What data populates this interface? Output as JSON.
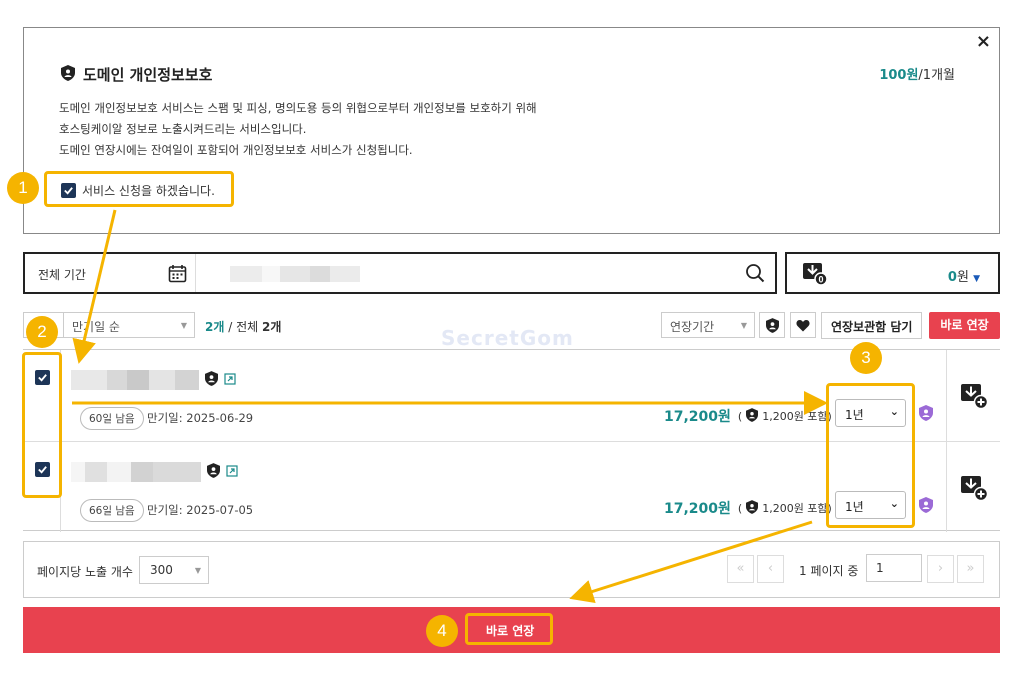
{
  "info": {
    "title": "도메인 개인정보보호",
    "price_strong": "100원",
    "price_suffix": "/1개월",
    "desc_1": "도메인 개인정보보호 서비스는 스팸 및 피싱, 명의도용 등의 위협으로부터 개인정보를 보호하기 위해",
    "desc_2": "호스팅케이알 정보로 노출시켜드리는 서비스입니다.",
    "desc_3": "도메인 연장시에는 잔여일이 포함되어 개인정보보호 서비스가 신청됩니다.",
    "service_check_label": "서비스 신청을 하겠습니다.",
    "close_label": "×"
  },
  "search": {
    "period_label": "전체 기간"
  },
  "cart": {
    "amount": "0",
    "unit": "원"
  },
  "toolbar": {
    "sort_label": "만기일 순",
    "count_selected": "2개",
    "count_sep": " / 전체 ",
    "count_total": "2개",
    "period_filter_label": "연장기간",
    "add_cart_label": "연장보관함 담기",
    "renew_now_label": "바로 연장"
  },
  "watermark": "SecretGom",
  "domains": [
    {
      "days_left": "60일 남음",
      "expiry": "만기일: 2025-06-29",
      "price": "17,200원",
      "price_open": "(",
      "privacy_fee": "1,200원 포함)",
      "period": "1년"
    },
    {
      "days_left": "66일 남음",
      "expiry": "만기일: 2025-07-05",
      "price": "17,200원",
      "price_open": "(",
      "privacy_fee": "1,200원 포함)",
      "period": "1년"
    }
  ],
  "pagination": {
    "per_page_label": "페이지당 노출 개수",
    "per_page_value": "300",
    "page_total_text": "1 페이지 중",
    "current_page": "1",
    "first": "«",
    "prev": "‹",
    "next": "›",
    "last": "»"
  },
  "bottom": {
    "renew_label": "바로 연장"
  },
  "annotations": [
    "1",
    "2",
    "3",
    "4"
  ],
  "colors": {
    "accent_teal": "#1a8a8a",
    "renew_red": "#e8424f",
    "annotation_orange": "#f5b400",
    "checkbox_navy": "#1d3557",
    "privacy_purple": "#9b6ad6"
  }
}
